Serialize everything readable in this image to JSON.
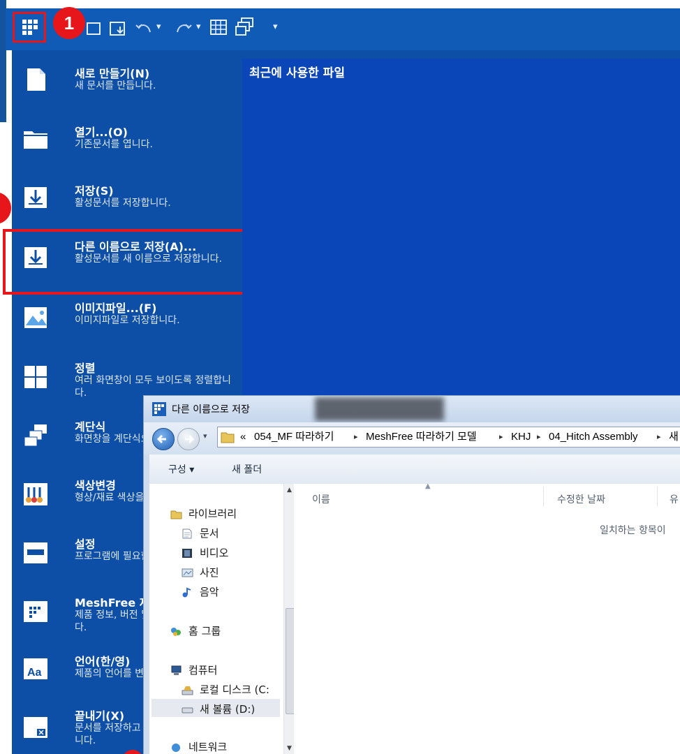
{
  "badges": [
    "1"
  ],
  "backstage": {
    "items": [
      {
        "title": "새로 만들기(N)",
        "desc": "새 문서를 만듭니다.",
        "icon": "new-document-icon"
      },
      {
        "title": "열기...(O)",
        "desc": "기존문서를 엽니다.",
        "icon": "folder-open-icon"
      },
      {
        "title": "저장(S)",
        "desc": "활성문서를 저장합니다.",
        "icon": "save-icon"
      },
      {
        "title": "다른 이름으로 저장(A)...",
        "desc": "활성문서를 새 이름으로 저장합니다.",
        "icon": "save-as-icon"
      },
      {
        "title": "이미지파일...(F)",
        "desc": "이미지파일로 저장합니다.",
        "icon": "image-file-icon"
      },
      {
        "title": "정렬",
        "desc": "여러 화면창이 모두 보이도록 정렬합니다.",
        "icon": "arrange-windows-icon"
      },
      {
        "title": "계단식",
        "desc": "화면창을 계단식으로 정렬합니다.",
        "icon": "cascade-windows-icon"
      },
      {
        "title": "색상변경",
        "desc": "형상/재료 색상을 변경합니다.",
        "icon": "color-change-icon"
      },
      {
        "title": "설정",
        "desc": "프로그램에 필요한 설정을 지정합니다.",
        "icon": "settings-icon"
      },
      {
        "title": "MeshFree 제품 정보",
        "desc": "제품 정보, 버전 및 저작권을 확인합니다.",
        "icon": "product-info-icon"
      },
      {
        "title": "언어(한/영)",
        "desc": "제품의 언어를 변경합니다.",
        "icon": "language-icon"
      },
      {
        "title": "끝내기(X)",
        "desc": "문서를 저장하고 응용 프로그램을 끝냅니다.",
        "icon": "exit-icon"
      }
    ]
  },
  "recent": {
    "title": "최근에 사용한 파일"
  },
  "dialog": {
    "title": "다른 이름으로 저장",
    "breadcrumb": {
      "prefix": "«",
      "parts": [
        "054_MF 따라하기",
        "MeshFree 따라하기 모델",
        "KHJ",
        "04_Hitch Assembly",
        "새"
      ]
    },
    "commands": {
      "organize": "구성 ▾",
      "new_folder": "새 폴더"
    },
    "nav": {
      "libraries": "라이브러리",
      "documents": "문서",
      "videos": "비디오",
      "pictures": "사진",
      "music": "음악",
      "homegroup": "홈 그룹",
      "computer": "컴퓨터",
      "local_disk": "로컬 디스크 (C:",
      "new_volume": "새 볼륨 (D:)",
      "network": "네트워크"
    },
    "columns": {
      "name": "이름",
      "date": "수정한 날짜",
      "type": "유"
    },
    "empty_message": "일치하는 항목이"
  },
  "colors": {
    "ribbon": "#0f5bb6",
    "backstage": "#0d4fa6",
    "recent": "#0a46b7",
    "highlight": "#e7161b"
  }
}
